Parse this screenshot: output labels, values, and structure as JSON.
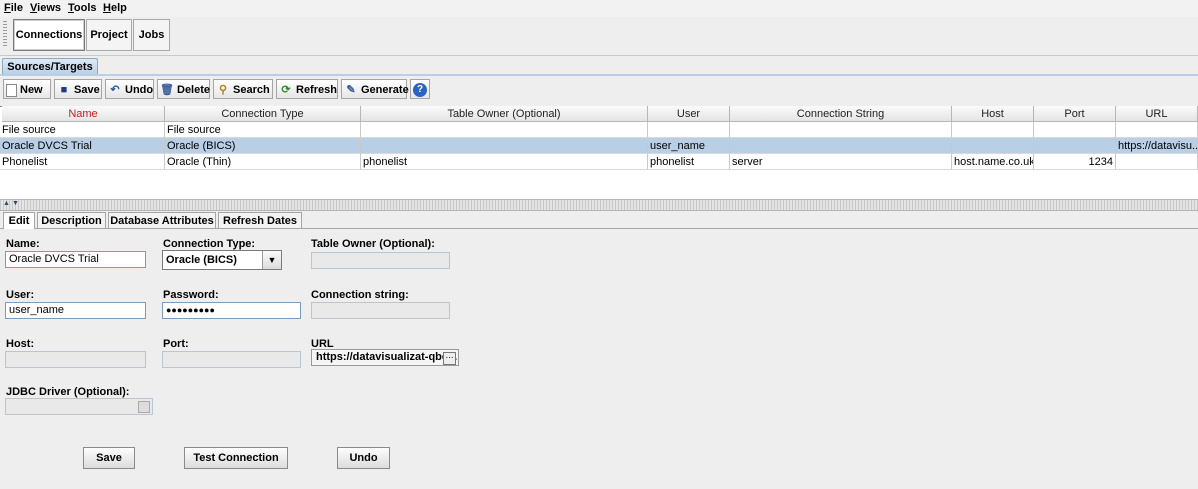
{
  "menu": {
    "file": {
      "mnemonic": "F",
      "rest": "ile"
    },
    "views": {
      "mnemonic": "V",
      "rest": "iews"
    },
    "tools": {
      "mnemonic": "T",
      "rest": "ools"
    },
    "help": {
      "mnemonic": "H",
      "rest": "elp"
    }
  },
  "top_tabs": [
    "Connections",
    "Project",
    "Jobs"
  ],
  "subtab": "Sources/Targets",
  "toolbar": {
    "new": "New",
    "save": "Save",
    "undo": "Undo",
    "delete": "Delete",
    "search": "Search",
    "refresh": "Refresh",
    "generate": "Generate",
    "help_glyph": "?"
  },
  "table": {
    "columns": [
      "Name",
      "Connection Type",
      "Table Owner (Optional)",
      "User",
      "Connection String",
      "Host",
      "Port",
      "URL"
    ],
    "rows": [
      [
        "File source",
        "File source",
        "",
        "",
        "",
        "",
        "",
        ""
      ],
      [
        "Oracle DVCS Trial",
        "Oracle (BICS)",
        "",
        "user_name",
        "",
        "",
        "",
        "https://datavisu..."
      ],
      [
        "Phonelist",
        "Oracle (Thin)",
        "phonelist",
        "phonelist",
        "server",
        "host.name.co.uk",
        "1234",
        ""
      ]
    ],
    "selected_row": 1
  },
  "lower_tabs": [
    "Edit",
    "Description",
    "Database Attributes",
    "Refresh Dates"
  ],
  "form": {
    "name_label": "Name:",
    "name_value": "Oracle DVCS Trial",
    "conn_type_label": "Connection Type:",
    "conn_type_value": "Oracle (BICS)",
    "table_owner_label": "Table Owner (Optional):",
    "user_label": "User:",
    "user_value": "user_name",
    "password_label": "Password:",
    "password_value": "●●●●●●●●●",
    "conn_string_label": "Connection string:",
    "host_label": "Host:",
    "port_label": "Port:",
    "url_label": "URL",
    "url_value": "https://datavisualizat-qbe...",
    "jdbc_label": "JDBC Driver (Optional):"
  },
  "buttons": {
    "save": "Save",
    "test": "Test Connection",
    "undo": "Undo"
  },
  "colors": {
    "selected_row": "#b8cfe5",
    "name_header": "#c81e1e"
  }
}
